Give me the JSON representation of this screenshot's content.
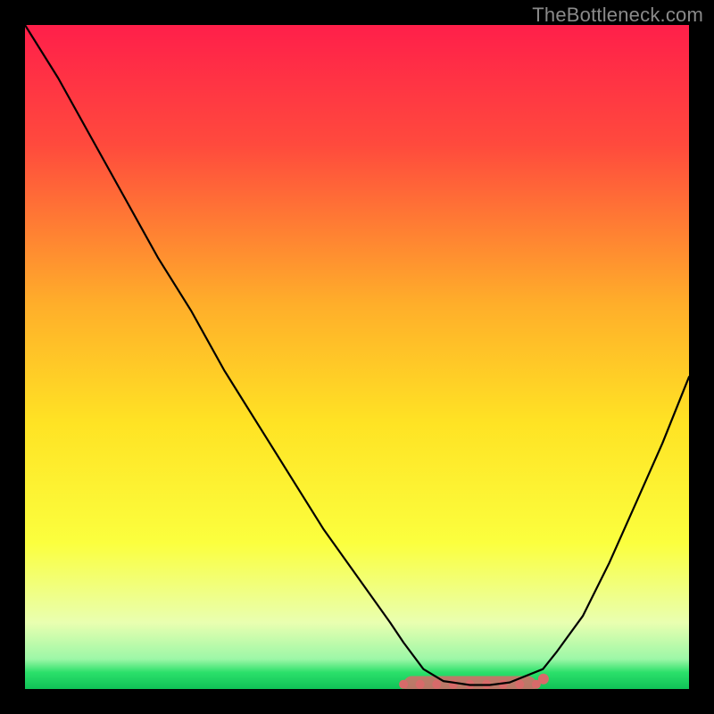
{
  "watermark": "TheBottleneck.com",
  "chart_data": {
    "type": "line",
    "title": "",
    "xlabel": "",
    "ylabel": "",
    "xlim": [
      0,
      100
    ],
    "ylim": [
      0,
      100
    ],
    "gradient_stops": [
      {
        "offset": 0.0,
        "color": "#ff1f4a"
      },
      {
        "offset": 0.18,
        "color": "#ff4a3d"
      },
      {
        "offset": 0.42,
        "color": "#ffae2a"
      },
      {
        "offset": 0.6,
        "color": "#ffe324"
      },
      {
        "offset": 0.78,
        "color": "#fbff3e"
      },
      {
        "offset": 0.9,
        "color": "#e9ffb0"
      },
      {
        "offset": 0.955,
        "color": "#9cf7a7"
      },
      {
        "offset": 0.975,
        "color": "#2be06a"
      },
      {
        "offset": 1.0,
        "color": "#10c257"
      }
    ],
    "series": [
      {
        "name": "bottleneck-curve",
        "x": [
          0,
          5,
          10,
          15,
          20,
          25,
          30,
          35,
          40,
          45,
          50,
          55,
          57,
          60,
          63,
          67,
          70,
          73,
          78,
          80,
          84,
          88,
          92,
          96,
          100
        ],
        "y": [
          100,
          92,
          83,
          74,
          65,
          57,
          48,
          40,
          32,
          24,
          17,
          10,
          7,
          3,
          1.2,
          0.6,
          0.6,
          1.0,
          3.0,
          5.5,
          11,
          19,
          28,
          37,
          47
        ],
        "stroke": "#000000",
        "stroke_width": 2.2
      }
    ],
    "flat_region": {
      "start_x": 57,
      "end_x": 77,
      "y": 0.7,
      "color": "#d86a6a",
      "dot_radius": 5,
      "band_height": 2.5
    }
  }
}
